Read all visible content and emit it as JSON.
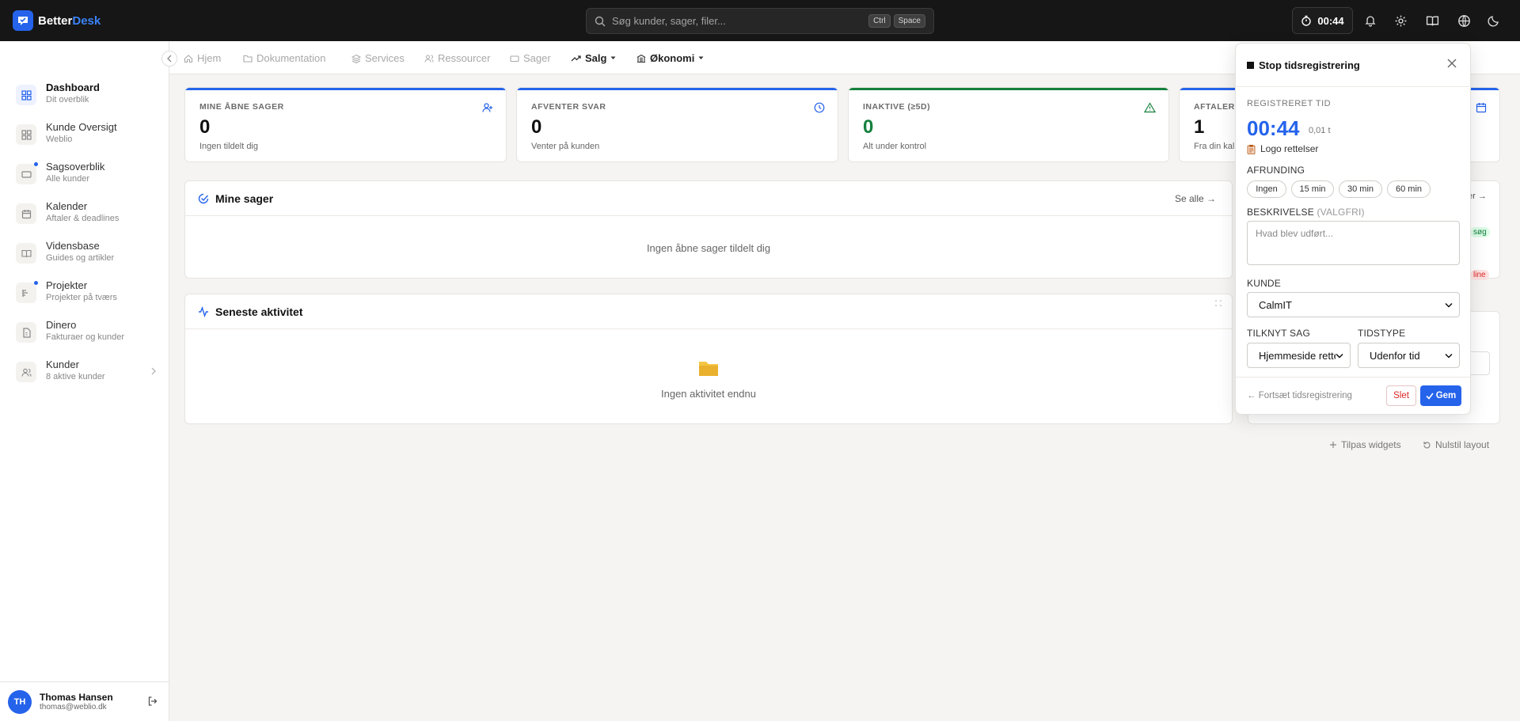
{
  "app": {
    "name_part1": "Better",
    "name_part2": "Desk"
  },
  "search": {
    "placeholder": "Søg kunder, sager, filer...",
    "kbd1": "Ctrl",
    "kbd2": "Space"
  },
  "timer": {
    "value": "00:44"
  },
  "topbar_icons": [
    "bell-icon",
    "gear-icon",
    "book-icon",
    "globe-icon",
    "moon-icon"
  ],
  "sidebar": {
    "items": [
      {
        "label": "Dashboard",
        "sub": "Dit overblik",
        "icon": "dashboard-icon",
        "active": true
      },
      {
        "label": "Kunde Oversigt",
        "sub": "Weblio",
        "icon": "grid-icon"
      },
      {
        "label": "Sagsoverblik",
        "sub": "Alle kunder",
        "icon": "ticket-icon",
        "dot": true
      },
      {
        "label": "Kalender",
        "sub": "Aftaler & deadlines",
        "icon": "calendar-icon"
      },
      {
        "label": "Vidensbase",
        "sub": "Guides og artikler",
        "icon": "book-icon"
      },
      {
        "label": "Projekter",
        "sub": "Projekter på tværs",
        "icon": "kanban-icon",
        "dot": true
      },
      {
        "label": "Dinero",
        "sub": "Fakturaer og kunder",
        "icon": "invoice-icon"
      },
      {
        "label": "Kunder",
        "sub": "8 aktive kunder",
        "icon": "users-icon"
      }
    ]
  },
  "user": {
    "initials": "TH",
    "name": "Thomas Hansen",
    "email": "thomas@weblio.dk"
  },
  "tabs": [
    {
      "label": "Hjem",
      "icon": "home-icon"
    },
    {
      "label": "Dokumentation",
      "icon": "folder-icon"
    },
    {
      "label": "Services",
      "icon": "layers-icon"
    },
    {
      "label": "Ressourcer",
      "icon": "people-icon"
    },
    {
      "label": "Sager",
      "icon": "ticket-icon"
    },
    {
      "label": "Salg",
      "icon": "trend-icon"
    },
    {
      "label": "Økonomi",
      "icon": "bank-icon"
    }
  ],
  "stats": [
    {
      "title": "MINE ÅBNE SAGER",
      "value": "0",
      "sub": "Ingen tildelt dig",
      "color": "#2563eb",
      "icon": "user-plus-icon"
    },
    {
      "title": "AFVENTER SVAR",
      "value": "0",
      "sub": "Venter på kunden",
      "color": "#2563eb",
      "icon": "clock-icon"
    },
    {
      "title": "INAKTIVE (≥5D)",
      "value": "0",
      "sub": "Alt under kontrol",
      "color": "#15803d",
      "icon": "warning-icon"
    },
    {
      "title": "AFTALER I",
      "value": "1",
      "sub": "Fra din kal",
      "color": "#2563eb",
      "icon": "calendar-icon"
    }
  ],
  "mine_sager": {
    "title": "Mine sager",
    "see_all": "Se alle →",
    "empty": "Ingen åbne sager tildelt dig"
  },
  "activity": {
    "title": "Seneste aktivitet",
    "empty": "Ingen aktivitet endnu"
  },
  "footer": {
    "customize": "Tilpas widgets",
    "reset": "Nulstil layout"
  },
  "peek": {
    "link": "er →",
    "badge1": "søg",
    "badge2": "line"
  },
  "time_popover": {
    "title": "Stop tidsregistrering",
    "registered_label": "REGISTRERET TID",
    "time": "00:44",
    "hours": "0,01 t",
    "task": "Logo rettelser",
    "rounding_label": "AFRUNDING",
    "rounding_options": [
      "Ingen",
      "15 min",
      "30 min",
      "60 min"
    ],
    "description_label": "BESKRIVELSE",
    "description_optional": "(VALGFRI)",
    "description_placeholder": "Hvad blev udført...",
    "customer_label": "KUNDE",
    "customer_value": "CalmIT",
    "case_label": "TILKNYT SAG",
    "case_value": "Hjemmeside rettelser",
    "timetype_label": "TIDSTYPE",
    "timetype_value": "Udenfor tid",
    "continue": "← Fortsæt tidsregistrering",
    "delete": "Slet",
    "save": "Gem"
  }
}
